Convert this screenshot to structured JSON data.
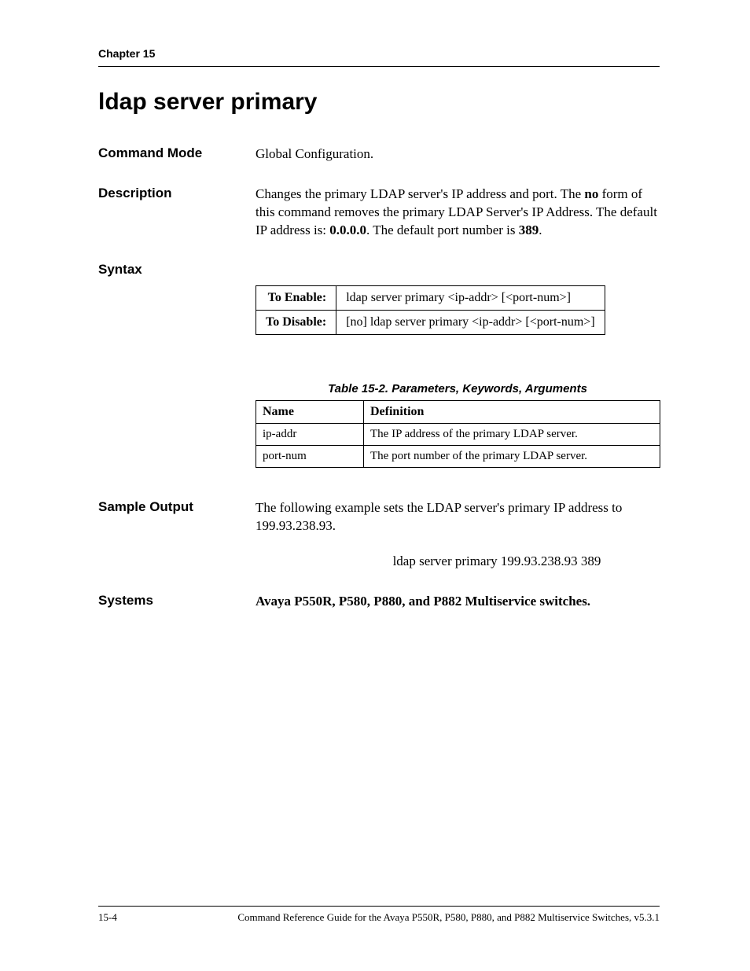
{
  "chapter": "Chapter 15",
  "title": "ldap server primary",
  "command_mode": {
    "label": "Command Mode",
    "text": "Global Configuration."
  },
  "description": {
    "label": "Description",
    "pre": "Changes the primary LDAP server's IP address and port. The ",
    "bold1": "no",
    "mid1": " form of this command removes the primary LDAP Server's IP Address. The default IP address is: ",
    "bold2": "0.0.0.0",
    "mid2": ". The default port number is ",
    "bold3": "389",
    "post": "."
  },
  "syntax": {
    "label": "Syntax",
    "enable_label": "To Enable:",
    "enable_value": "ldap server primary <ip-addr> [<port-num>]",
    "disable_label": "To Disable:",
    "disable_value": "[no] ldap server primary <ip-addr> [<port-num>]"
  },
  "param_table": {
    "caption": "Table 15-2.  Parameters, Keywords, Arguments",
    "headers": {
      "name": "Name",
      "definition": "Definition"
    },
    "rows": [
      {
        "name": "ip-addr",
        "definition": "The IP address of the primary LDAP server."
      },
      {
        "name": "port-num",
        "definition": "The port number of the primary LDAP server."
      }
    ]
  },
  "sample_output": {
    "label": "Sample Output",
    "text": "The following example sets the LDAP server's primary IP address to 199.93.238.93.",
    "code": "ldap server primary 199.93.238.93 389"
  },
  "systems": {
    "label": "Systems",
    "text": "Avaya P550R, P580, P880, and P882 Multiservice switches."
  },
  "footer": {
    "page_num": "15-4",
    "text": "Command Reference Guide for the Avaya P550R, P580, P880, and P882 Multiservice Switches, v5.3.1"
  }
}
